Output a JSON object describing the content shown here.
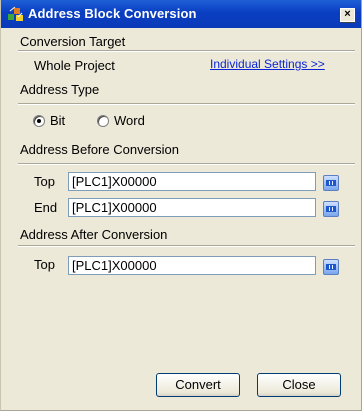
{
  "window": {
    "title": "Address Block Conversion",
    "close_label": "×"
  },
  "conversion_target": {
    "label": "Conversion Target",
    "whole_project": "Whole Project",
    "individual_settings_link": "Individual Settings >>"
  },
  "address_type": {
    "label": "Address Type",
    "options": [
      {
        "label": "Bit",
        "selected": true
      },
      {
        "label": "Word",
        "selected": false
      }
    ]
  },
  "before": {
    "label": "Address Before Conversion",
    "top_label": "Top",
    "top_value": "[PLC1]X00000",
    "end_label": "End",
    "end_value": "[PLC1]X00000"
  },
  "after": {
    "label": "Address After Conversion",
    "top_label": "Top",
    "top_value": "[PLC1]X00000"
  },
  "buttons": {
    "convert": "Convert",
    "close": "Close"
  },
  "colors": {
    "titlebar": "#0a3ec2",
    "link": "#0b24d6",
    "dialog_bg": "#ece9d8"
  }
}
